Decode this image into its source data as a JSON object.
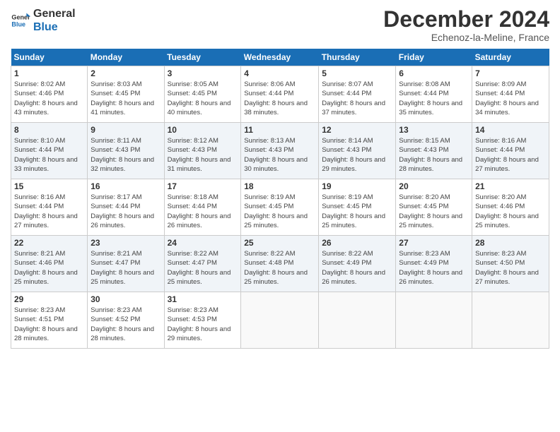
{
  "logo": {
    "line1": "General",
    "line2": "Blue"
  },
  "title": "December 2024",
  "subtitle": "Echenoz-la-Meline, France",
  "days_header": [
    "Sunday",
    "Monday",
    "Tuesday",
    "Wednesday",
    "Thursday",
    "Friday",
    "Saturday"
  ],
  "weeks": [
    [
      {
        "num": "1",
        "rise": "8:02 AM",
        "set": "4:46 PM",
        "hours": "8 hours and 43 minutes."
      },
      {
        "num": "2",
        "rise": "8:03 AM",
        "set": "4:45 PM",
        "hours": "8 hours and 41 minutes."
      },
      {
        "num": "3",
        "rise": "8:05 AM",
        "set": "4:45 PM",
        "hours": "8 hours and 40 minutes."
      },
      {
        "num": "4",
        "rise": "8:06 AM",
        "set": "4:44 PM",
        "hours": "8 hours and 38 minutes."
      },
      {
        "num": "5",
        "rise": "8:07 AM",
        "set": "4:44 PM",
        "hours": "8 hours and 37 minutes."
      },
      {
        "num": "6",
        "rise": "8:08 AM",
        "set": "4:44 PM",
        "hours": "8 hours and 35 minutes."
      },
      {
        "num": "7",
        "rise": "8:09 AM",
        "set": "4:44 PM",
        "hours": "8 hours and 34 minutes."
      }
    ],
    [
      {
        "num": "8",
        "rise": "8:10 AM",
        "set": "4:44 PM",
        "hours": "8 hours and 33 minutes."
      },
      {
        "num": "9",
        "rise": "8:11 AM",
        "set": "4:43 PM",
        "hours": "8 hours and 32 minutes."
      },
      {
        "num": "10",
        "rise": "8:12 AM",
        "set": "4:43 PM",
        "hours": "8 hours and 31 minutes."
      },
      {
        "num": "11",
        "rise": "8:13 AM",
        "set": "4:43 PM",
        "hours": "8 hours and 30 minutes."
      },
      {
        "num": "12",
        "rise": "8:14 AM",
        "set": "4:43 PM",
        "hours": "8 hours and 29 minutes."
      },
      {
        "num": "13",
        "rise": "8:15 AM",
        "set": "4:43 PM",
        "hours": "8 hours and 28 minutes."
      },
      {
        "num": "14",
        "rise": "8:16 AM",
        "set": "4:44 PM",
        "hours": "8 hours and 27 minutes."
      }
    ],
    [
      {
        "num": "15",
        "rise": "8:16 AM",
        "set": "4:44 PM",
        "hours": "8 hours and 27 minutes."
      },
      {
        "num": "16",
        "rise": "8:17 AM",
        "set": "4:44 PM",
        "hours": "8 hours and 26 minutes."
      },
      {
        "num": "17",
        "rise": "8:18 AM",
        "set": "4:44 PM",
        "hours": "8 hours and 26 minutes."
      },
      {
        "num": "18",
        "rise": "8:19 AM",
        "set": "4:45 PM",
        "hours": "8 hours and 25 minutes."
      },
      {
        "num": "19",
        "rise": "8:19 AM",
        "set": "4:45 PM",
        "hours": "8 hours and 25 minutes."
      },
      {
        "num": "20",
        "rise": "8:20 AM",
        "set": "4:45 PM",
        "hours": "8 hours and 25 minutes."
      },
      {
        "num": "21",
        "rise": "8:20 AM",
        "set": "4:46 PM",
        "hours": "8 hours and 25 minutes."
      }
    ],
    [
      {
        "num": "22",
        "rise": "8:21 AM",
        "set": "4:46 PM",
        "hours": "8 hours and 25 minutes."
      },
      {
        "num": "23",
        "rise": "8:21 AM",
        "set": "4:47 PM",
        "hours": "8 hours and 25 minutes."
      },
      {
        "num": "24",
        "rise": "8:22 AM",
        "set": "4:47 PM",
        "hours": "8 hours and 25 minutes."
      },
      {
        "num": "25",
        "rise": "8:22 AM",
        "set": "4:48 PM",
        "hours": "8 hours and 25 minutes."
      },
      {
        "num": "26",
        "rise": "8:22 AM",
        "set": "4:49 PM",
        "hours": "8 hours and 26 minutes."
      },
      {
        "num": "27",
        "rise": "8:23 AM",
        "set": "4:49 PM",
        "hours": "8 hours and 26 minutes."
      },
      {
        "num": "28",
        "rise": "8:23 AM",
        "set": "4:50 PM",
        "hours": "8 hours and 27 minutes."
      }
    ],
    [
      {
        "num": "29",
        "rise": "8:23 AM",
        "set": "4:51 PM",
        "hours": "8 hours and 28 minutes."
      },
      {
        "num": "30",
        "rise": "8:23 AM",
        "set": "4:52 PM",
        "hours": "8 hours and 28 minutes."
      },
      {
        "num": "31",
        "rise": "8:23 AM",
        "set": "4:53 PM",
        "hours": "8 hours and 29 minutes."
      },
      null,
      null,
      null,
      null
    ]
  ],
  "labels": {
    "sunrise": "Sunrise:",
    "sunset": "Sunset:",
    "daylight": "Daylight:"
  }
}
